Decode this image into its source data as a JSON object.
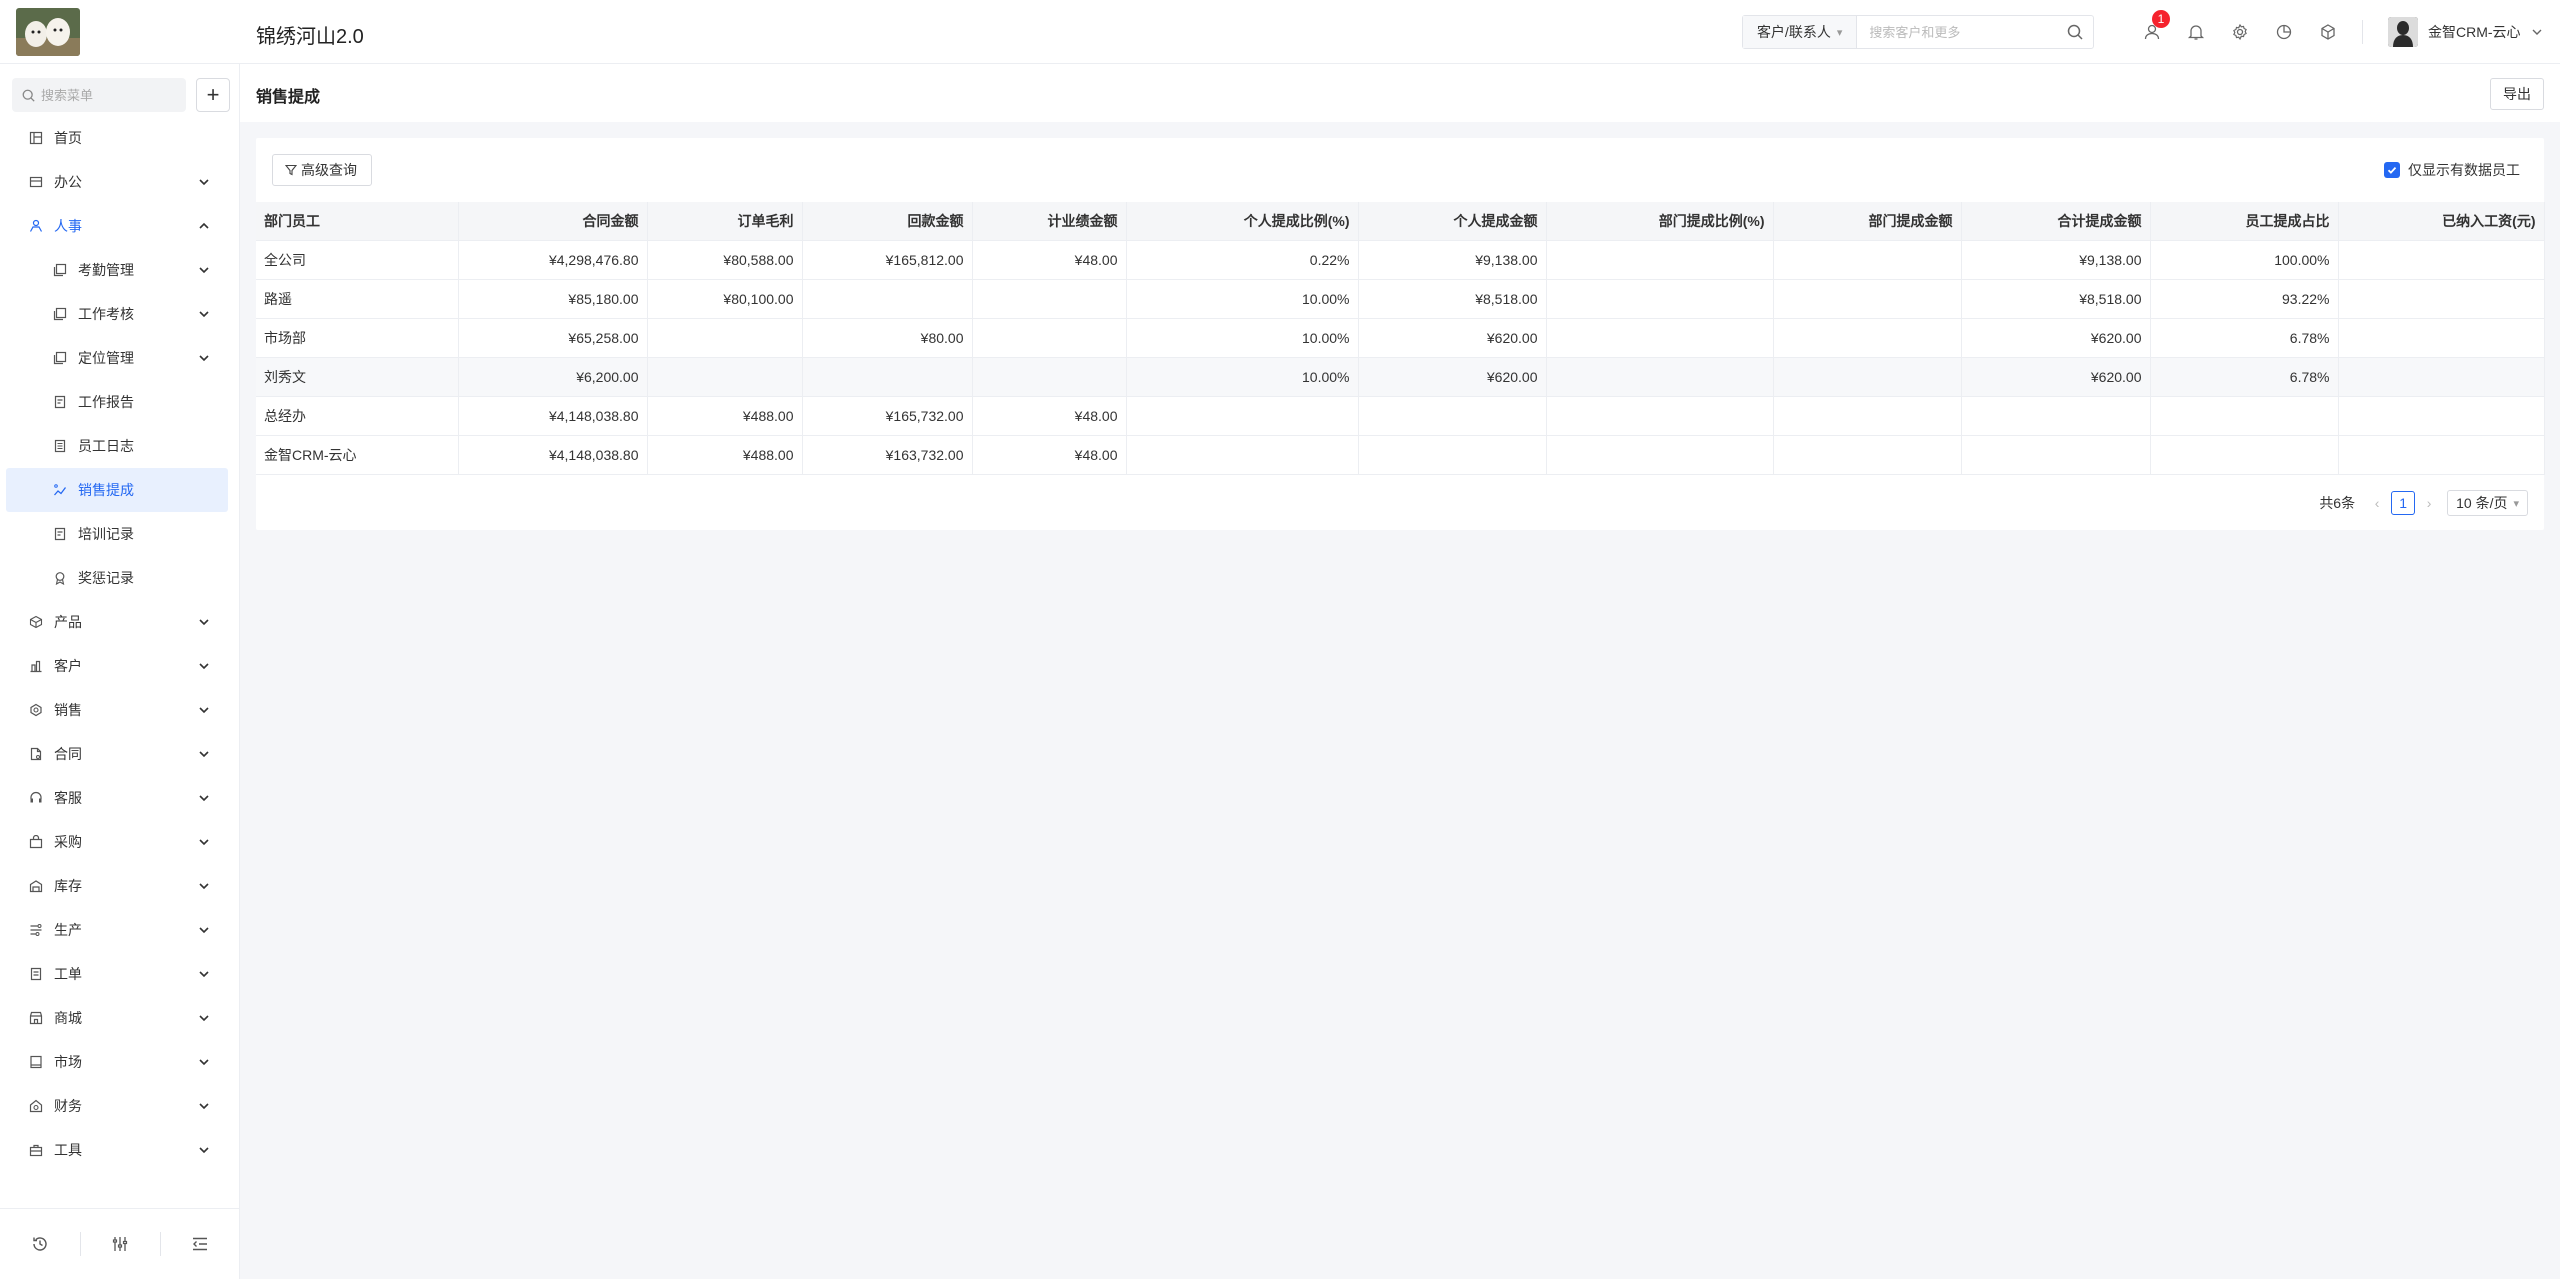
{
  "app": {
    "title": "锦绣河山2.0"
  },
  "header": {
    "search": {
      "scope": "客户/联系人",
      "placeholder": "搜索客户和更多"
    },
    "notification_count": "1",
    "user_name": "金智CRM-云心"
  },
  "sidebar": {
    "search_placeholder": "搜索菜单",
    "items": [
      {
        "label": "首页",
        "icon": "home-icon"
      },
      {
        "label": "办公",
        "icon": "office-icon"
      },
      {
        "label": "人事",
        "icon": "hr-icon"
      },
      {
        "label": "考勤管理",
        "icon": "attendance-icon"
      },
      {
        "label": "工作考核",
        "icon": "assessment-icon"
      },
      {
        "label": "定位管理",
        "icon": "location-icon"
      },
      {
        "label": "工作报告",
        "icon": "report-icon"
      },
      {
        "label": "员工日志",
        "icon": "log-icon"
      },
      {
        "label": "销售提成",
        "icon": "commission-icon"
      },
      {
        "label": "培训记录",
        "icon": "training-icon"
      },
      {
        "label": "奖惩记录",
        "icon": "award-icon"
      },
      {
        "label": "产品",
        "icon": "product-icon"
      },
      {
        "label": "客户",
        "icon": "customer-icon"
      },
      {
        "label": "销售",
        "icon": "sales-icon"
      },
      {
        "label": "合同",
        "icon": "contract-icon"
      },
      {
        "label": "客服",
        "icon": "service-icon"
      },
      {
        "label": "采购",
        "icon": "purchase-icon"
      },
      {
        "label": "库存",
        "icon": "inventory-icon"
      },
      {
        "label": "生产",
        "icon": "production-icon"
      },
      {
        "label": "工单",
        "icon": "workorder-icon"
      },
      {
        "label": "商城",
        "icon": "mall-icon"
      },
      {
        "label": "市场",
        "icon": "market-icon"
      },
      {
        "label": "财务",
        "icon": "finance-icon"
      },
      {
        "label": "工具",
        "icon": "tools-icon"
      }
    ]
  },
  "page": {
    "title": "销售提成",
    "export_label": "导出",
    "advanced_query_label": "高级查询",
    "only_data_staff_label": "仅显示有数据员工",
    "only_data_staff_checked": true
  },
  "table": {
    "headers": [
      "部门员工",
      "合同金额",
      "订单毛利",
      "回款金额",
      "计业绩金额",
      "个人提成比例(%)",
      "个人提成金额",
      "部门提成比例(%)",
      "部门提成金额",
      "合计提成金额",
      "员工提成占比",
      "已纳入工资(元)"
    ],
    "rows": [
      [
        "全公司",
        "¥4,298,476.80",
        "¥80,588.00",
        "¥165,812.00",
        "¥48.00",
        "0.22%",
        "¥9,138.00",
        "",
        "",
        "¥9,138.00",
        "100.00%",
        ""
      ],
      [
        "路遥",
        "¥85,180.00",
        "¥80,100.00",
        "",
        "",
        "10.00%",
        "¥8,518.00",
        "",
        "",
        "¥8,518.00",
        "93.22%",
        ""
      ],
      [
        "市场部",
        "¥65,258.00",
        "",
        "¥80.00",
        "",
        "10.00%",
        "¥620.00",
        "",
        "",
        "¥620.00",
        "6.78%",
        ""
      ],
      [
        "刘秀文",
        "¥6,200.00",
        "",
        "",
        "",
        "10.00%",
        "¥620.00",
        "",
        "",
        "¥620.00",
        "6.78%",
        ""
      ],
      [
        "总经办",
        "¥4,148,038.80",
        "¥488.00",
        "¥165,732.00",
        "¥48.00",
        "",
        "",
        "",
        "",
        "",
        "",
        ""
      ],
      [
        "金智CRM-云心",
        "¥4,148,038.80",
        "¥488.00",
        "¥163,732.00",
        "¥48.00",
        "",
        "",
        "",
        "",
        "",
        "",
        ""
      ]
    ]
  },
  "pagination": {
    "total": "共6条",
    "current_page": "1",
    "page_size": "10 条/页"
  },
  "colors": {
    "primary": "#2468f2",
    "badge": "#f5222d"
  }
}
